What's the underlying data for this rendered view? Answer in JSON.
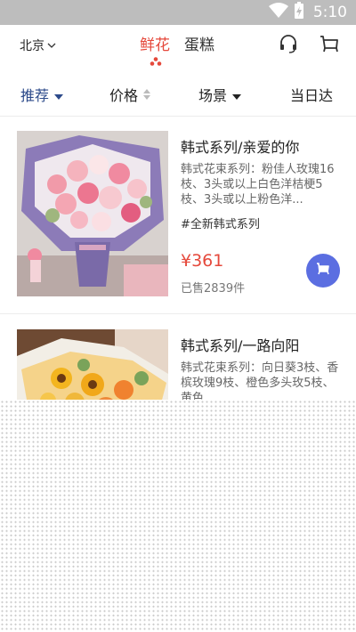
{
  "status_bar": {
    "time": "5:10",
    "icons": [
      "wifi-icon",
      "battery-charging-icon"
    ]
  },
  "header": {
    "city": "北京",
    "tabs": [
      {
        "label": "鲜花",
        "active": true
      },
      {
        "label": "蛋糕",
        "active": false
      }
    ],
    "icons": [
      "headset-icon",
      "cart-icon"
    ]
  },
  "filters": [
    {
      "label": "推荐",
      "active": true,
      "icon": "triangle-down-icon"
    },
    {
      "label": "价格",
      "active": false,
      "icon": "sort-updown-icon"
    },
    {
      "label": "场景",
      "active": false,
      "icon": "triangle-down-icon"
    },
    {
      "label": "当日达",
      "active": false
    }
  ],
  "products": [
    {
      "title": "韩式系列/亲爱的你",
      "description": "韩式花束系列：粉佳人玫瑰16枝、3头或以上白色洋桔梗5枝、3头或以上粉色洋...",
      "tag": "#全新韩式系列",
      "price": "¥361",
      "sold": "已售2839件"
    },
    {
      "title": "韩式系列/一路向阳",
      "description": "韩式花束系列：向日葵3枝、香槟玫瑰9枝、橙色多头玫5枝、黄色..."
    }
  ],
  "colors": {
    "accent_red": "#e5483b",
    "filter_active": "#2c4a8a",
    "cart_button": "#5b6ee1"
  }
}
